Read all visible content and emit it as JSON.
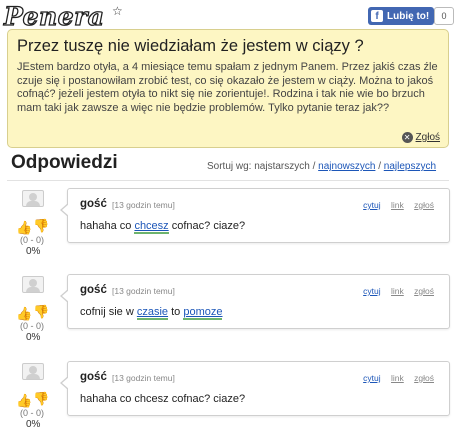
{
  "header": {
    "logo_text": "Penera",
    "logo_star": "☆",
    "fb_like_icon": "f",
    "fb_like_label": "Lubię to!",
    "fb_like_count": "0"
  },
  "question": {
    "title": "Przez tuszę nie wiedziałam że jestem w ciązy ?",
    "body": "JEstem bardzo otyła, a 4 miesiące temu spałam z jednym Panem. Przez jakiś czas źle czuje się i postanowiłam zrobić test, co się okazało że jestem w ciąży. Można to jakoś cofnąć? jeżeli jestem otyła to nikt się nie zorientuje!. Rodzina i tak nie wie bo brzuch mam taki jak zawsze a więc nie będzie problemów. Tylko pytanie teraz jak??",
    "report_label": "Zgłoś"
  },
  "answers_section": {
    "title": "Odpowiedzi",
    "sort_label": "Sortuj wg: najstarszych /",
    "sort_newest": "najnowszych",
    "sort_sep": " /",
    "sort_best": "najlepszych"
  },
  "answers": [
    {
      "author": "gość",
      "time": "[13 godzin temu]",
      "quote": "cytuj",
      "link": "link",
      "report": "zgłoś",
      "text_a": "hahaha co ",
      "keyword1": "chcesz",
      "text_b": " cofnac? ciaze?",
      "keyword2": "",
      "text_c": "",
      "score": "(0 - 0)",
      "percent": "0%"
    },
    {
      "author": "gość",
      "time": "[13 godzin temu]",
      "quote": "cytuj",
      "link": "link",
      "report": "zgłoś",
      "text_a": "cofnij sie w ",
      "keyword1": "czasie",
      "text_b": " to ",
      "keyword2": "pomoze",
      "text_c": "",
      "score": "(0 - 0)",
      "percent": "0%"
    },
    {
      "author": "gość",
      "time": "[13 godzin temu]",
      "quote": "cytuj",
      "link": "link",
      "report": "zgłoś",
      "text_a": "hahaha co chcesz cofnac? ciaze?",
      "keyword1": "",
      "text_b": "",
      "keyword2": "",
      "text_c": "",
      "score": "(0 - 0)",
      "percent": "0%"
    }
  ]
}
